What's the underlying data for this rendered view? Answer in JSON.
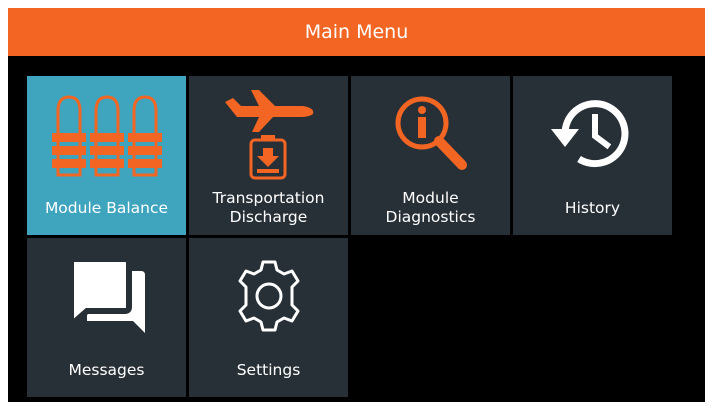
{
  "header": {
    "title": "Main Menu"
  },
  "colors": {
    "accent": "#f26522",
    "tile": "#283037",
    "selected": "#3fa4be"
  },
  "menu": [
    {
      "label": "Module Balance",
      "icon": "battery-modules-icon",
      "selected": true
    },
    {
      "label": "Transportation\nDischarge",
      "icon": "airplane-battery-discharge-icon",
      "selected": false
    },
    {
      "label": "Module\nDiagnostics",
      "icon": "info-magnifier-icon",
      "selected": false
    },
    {
      "label": "History",
      "icon": "history-clock-icon",
      "selected": false
    },
    {
      "label": "Messages",
      "icon": "chat-bubbles-icon",
      "selected": false
    },
    {
      "label": "Settings",
      "icon": "gear-icon",
      "selected": false
    }
  ]
}
